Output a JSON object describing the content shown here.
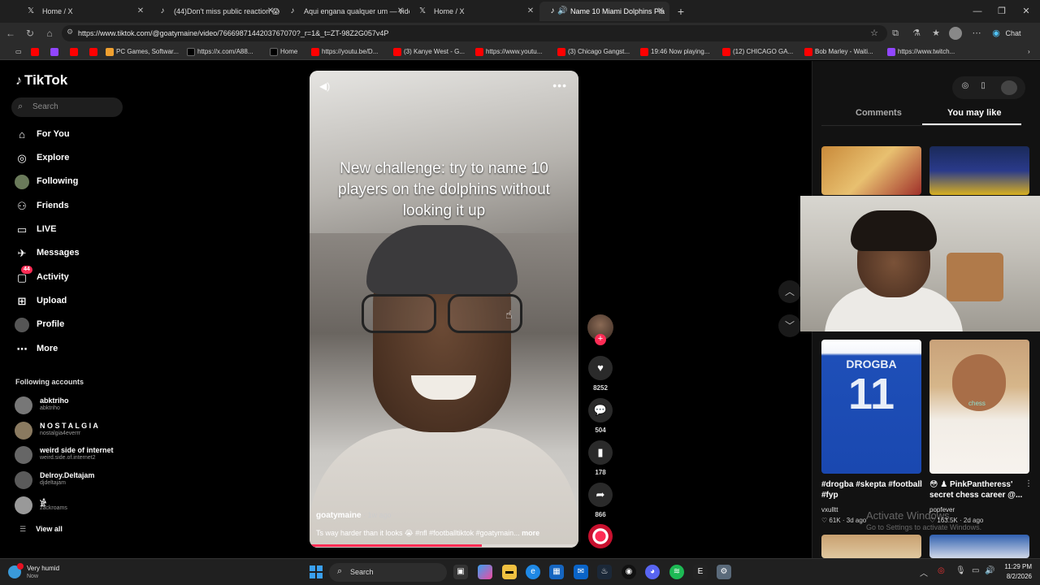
{
  "browser": {
    "tabs": [
      {
        "label": "Home / X",
        "icon": "x-logo-icon",
        "active": false
      },
      {
        "label": "(44)Don't miss public reaction 😱 | G",
        "icon": "tiktok-icon",
        "active": false
      },
      {
        "label": "Aqui engana qualquer um — vide",
        "icon": "tiktok-icon",
        "active": false
      },
      {
        "label": "Home / X",
        "icon": "x-logo-icon",
        "active": false
      },
      {
        "label": "Name 10 Miami Dolphins Pla",
        "icon": "tiktok-icon",
        "active": true
      }
    ],
    "url": "https://www.tiktok.com/@goatymaine/video/7666987144203767070?_r=1&_t=ZT-98Z2G057v4P",
    "chat_label": "Chat",
    "bookmarks": [
      {
        "label": "",
        "icon": "youtube-icon",
        "color": "#ff0000"
      },
      {
        "label": "",
        "icon": "twitch-icon",
        "color": "#9146ff"
      },
      {
        "label": "",
        "icon": "youtube-icon",
        "color": "#ff0000"
      },
      {
        "label": "",
        "icon": "youtube-icon",
        "color": "#ff0000"
      },
      {
        "label": "PC Games, Softwar...",
        "icon": "games-icon",
        "color": "#f0a030"
      },
      {
        "label": "https://x.com/A88...",
        "icon": "x-logo-icon",
        "color": "#000000"
      },
      {
        "label": "Home",
        "icon": "x-logo-icon",
        "color": "#000000"
      },
      {
        "label": "https://youtu.be/D...",
        "icon": "youtube-icon",
        "color": "#ff0000"
      },
      {
        "label": "(3) Kanye West - G...",
        "icon": "youtube-icon",
        "color": "#ff0000"
      },
      {
        "label": "https://www.youtu...",
        "icon": "youtube-icon",
        "color": "#ff0000"
      },
      {
        "label": "(3) Chicago Gangst...",
        "icon": "youtube-icon",
        "color": "#ff0000"
      },
      {
        "label": "19:46 Now playing...",
        "icon": "youtube-icon",
        "color": "#ff0000"
      },
      {
        "label": "(12) CHICAGO GA...",
        "icon": "youtube-icon",
        "color": "#ff0000"
      },
      {
        "label": "Bob Marley - Waiti...",
        "icon": "youtube-icon",
        "color": "#ff0000"
      },
      {
        "label": "https://www.twitch...",
        "icon": "twitch-icon",
        "color": "#9146ff"
      }
    ]
  },
  "sidebar": {
    "logo": "TikTok",
    "search_placeholder": "Search",
    "nav": [
      {
        "label": "For You",
        "icon": "home-icon"
      },
      {
        "label": "Explore",
        "icon": "compass-icon"
      },
      {
        "label": "Following",
        "icon": "following-icon"
      },
      {
        "label": "Friends",
        "icon": "friends-icon"
      },
      {
        "label": "LIVE",
        "icon": "live-icon"
      },
      {
        "label": "Messages",
        "icon": "messages-icon"
      },
      {
        "label": "Activity",
        "icon": "activity-icon",
        "badge": "44"
      },
      {
        "label": "Upload",
        "icon": "upload-icon"
      },
      {
        "label": "Profile",
        "icon": "profile-icon"
      },
      {
        "label": "More",
        "icon": "more-dots-icon"
      }
    ],
    "following_title": "Following accounts",
    "accounts": [
      {
        "name": "abktriho",
        "handle": "abktriho"
      },
      {
        "name": "N O S T A L G I A",
        "handle": "nostalgia4everrr"
      },
      {
        "name": "weird side of internet",
        "handle": "weird.side.of.internet2"
      },
      {
        "name": "Delroy.Deltajam",
        "handle": "djdeltajam"
      },
      {
        "name": "𓀀",
        "handle": "zackroams"
      }
    ],
    "view_all": "View all"
  },
  "video": {
    "caption": "New challenge: try to name 10 players on the dolphins without looking it up",
    "author": "goatymaine",
    "age": " · 1w ago",
    "description": "Ts way harder than it looks 😭 #nfl #footballtiktok #goatymain...",
    "more": "more",
    "progress": 0.64
  },
  "actions": {
    "likes": "8252",
    "comments": "504",
    "saves": "178",
    "shares": "866"
  },
  "right_panel": {
    "tab_comments": "Comments",
    "tab_you_may_like": "You may like",
    "items": [
      {
        "title": "#drogba #skepta #football #fyp",
        "user": "vxulltt",
        "likes": "61K",
        "age": "3d ago",
        "jersey_name": "DROGBA",
        "jersey_number": "11"
      },
      {
        "title": "😳 ♟ PinkPantheress' secret chess career @...",
        "user": "popfever",
        "likes": "163.5K",
        "age": "2d ago",
        "overlay": "chess"
      }
    ]
  },
  "watermark": {
    "line1": "Activate Windows",
    "line2": "Go to Settings to activate Windows."
  },
  "taskbar": {
    "weather_title": "Very humid",
    "weather_sub": "Now",
    "search": "Search",
    "time": "11:29 PM",
    "date": "8/2/2026"
  }
}
